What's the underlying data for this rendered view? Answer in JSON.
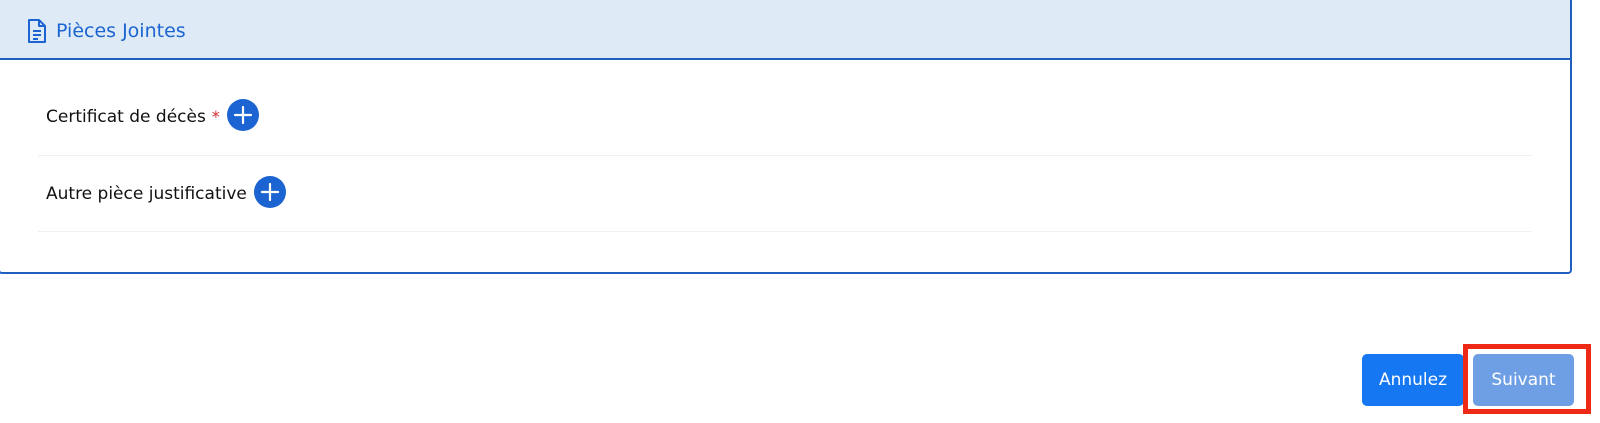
{
  "panel": {
    "title": "Pièces Jointes",
    "icon": "document-icon",
    "rows": [
      {
        "label": "Certificat de décès",
        "required": "*",
        "add_icon": "plus-circle-icon"
      },
      {
        "label": "Autre pièce justificative",
        "add_icon": "plus-circle-icon"
      }
    ]
  },
  "actions": {
    "cancel_label": "Annulez",
    "next_label": "Suivant"
  },
  "colors": {
    "accent": "#1c64d1",
    "header_bg": "#deebf7",
    "cancel_bg": "#1677f2",
    "next_bg": "#6e9fe4",
    "highlight": "#ee2a17",
    "required": "#d8282f"
  }
}
